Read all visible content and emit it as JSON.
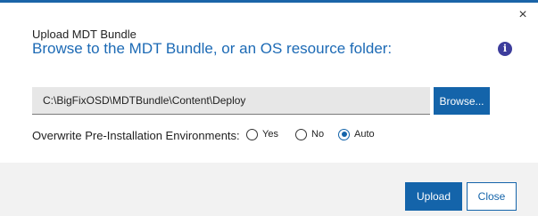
{
  "dialog": {
    "subtitle": "Upload MDT Bundle",
    "title": "Browse to the MDT Bundle, or an OS resource folder:",
    "close_glyph": "×",
    "info_glyph": "i"
  },
  "path": {
    "value": "C:\\BigFixOSD\\MDTBundle\\Content\\Deploy"
  },
  "browse_label": "Browse...",
  "overwrite": {
    "label": "Overwrite Pre-Installation Environments:",
    "options": [
      {
        "label": "Yes",
        "selected": false
      },
      {
        "label": "No",
        "selected": false
      },
      {
        "label": "Auto",
        "selected": true
      }
    ]
  },
  "footer": {
    "upload_label": "Upload",
    "close_label": "Close"
  },
  "colors": {
    "accent": "#1464aa",
    "title": "#1c6ab5",
    "info_icon": "#3d3d9c",
    "footer_bg": "#f2f2f2"
  },
  "icons": {
    "close": "close-icon",
    "info": "info-icon"
  }
}
